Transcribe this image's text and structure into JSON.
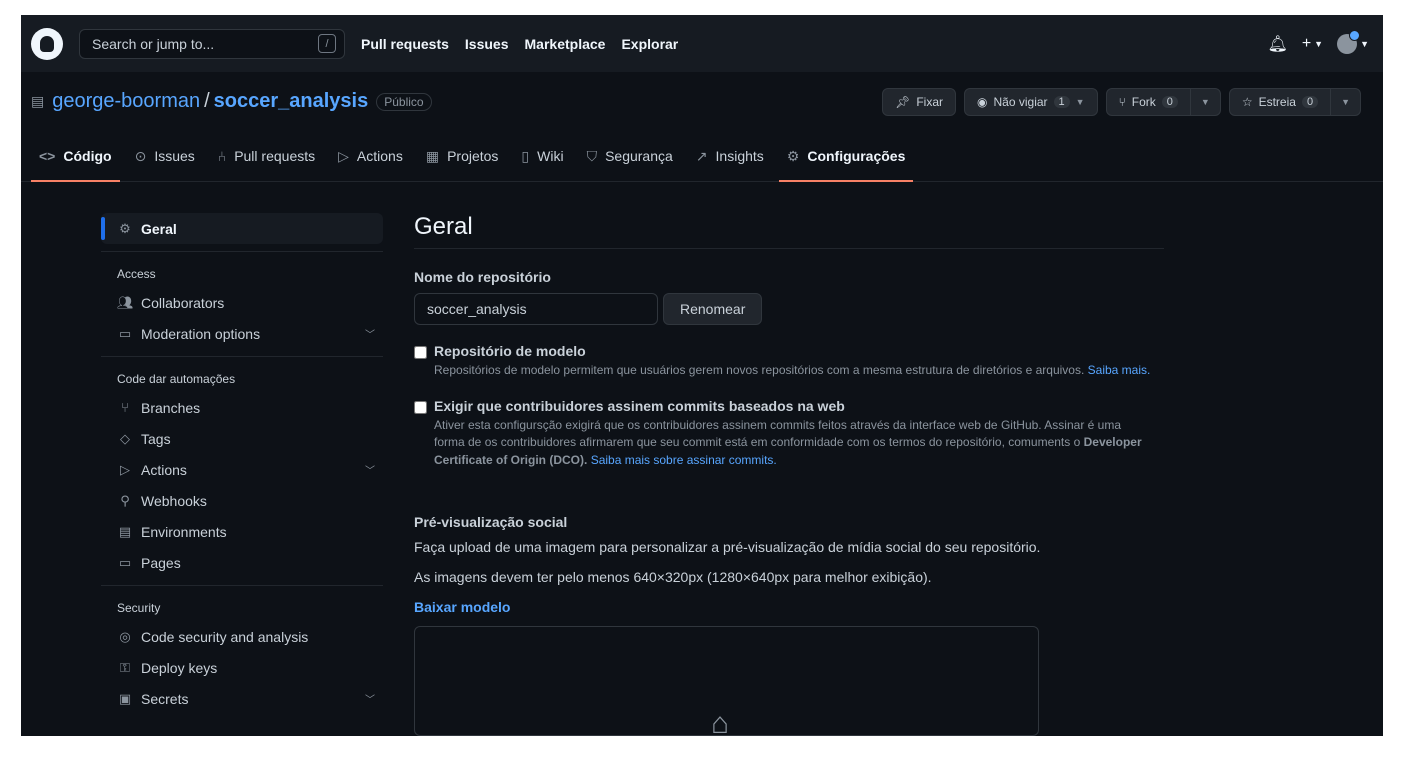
{
  "header": {
    "search_placeholder": "Search or jump to...",
    "search_shortcut": "/",
    "nav": [
      "Pull requests",
      "Issues",
      "Marketplace",
      "Explorar"
    ]
  },
  "repo": {
    "owner": "george-boorman",
    "separator": "/",
    "name": "soccer_analysis",
    "visibility": "Público",
    "pin_label": "Fixar",
    "watch_label": "Não vigiar",
    "watch_count": "1",
    "fork_label": "Fork",
    "fork_count": "0",
    "star_label": "Estreia",
    "star_count": "0"
  },
  "tabs": [
    {
      "label": "Código",
      "icon": "code-icon"
    },
    {
      "label": "Issues",
      "icon": "issue-icon"
    },
    {
      "label": "Pull requests",
      "icon": "pull-request-icon"
    },
    {
      "label": "Actions",
      "icon": "play-icon"
    },
    {
      "label": "Projetos",
      "icon": "table-icon"
    },
    {
      "label": "Wiki",
      "icon": "book-icon"
    },
    {
      "label": "Segurança",
      "icon": "shield-icon"
    },
    {
      "label": "Insights",
      "icon": "graph-icon"
    },
    {
      "label": "Configurações",
      "icon": "gear-icon"
    }
  ],
  "sidebar": {
    "general": "Geral",
    "access_heading": "Access",
    "access": [
      "Collaborators",
      "Moderation options"
    ],
    "code_heading": "Code dar automações",
    "code": [
      "Branches",
      "Tags",
      "Actions",
      "Webhooks",
      "Environments",
      "Pages"
    ],
    "security_heading": "Security",
    "security": [
      "Code security and analysis",
      "Deploy keys",
      "Secrets"
    ]
  },
  "main": {
    "title": "Geral",
    "repo_name_label": "Nome do repositório",
    "repo_name_value": "soccer_analysis",
    "rename_button": "Renomear",
    "template_title": "Repositório de modelo",
    "template_note": "Repositórios de modelo permitem que usuários gerem novos repositórios com a mesma estrutura de diretórios e arquivos.",
    "template_link": "Saiba mais.",
    "signoff_title": "Exigir que contribuidores assinem commits baseados na web",
    "signoff_note": "Ativer esta configursção exigirá que os contribuidores assinem commits feitos através da interface web de GitHub. Assinar é uma forma de os contribuidores afirmarem que seu commit está em conformidade com os termos do repositório, comuments o ",
    "signoff_strong": "Developer Certificate of Origin (DCO).",
    "signoff_link": "Saiba mais sobre assinar commits.",
    "social_title": "Pré-visualização social",
    "social_p1": "Faça upload de uma imagem para personalizar a pré-visualização de mídia social do seu repositório.",
    "social_p2": "As imagens devem ter pelo menos 640×320px (1280×640px para melhor exibição).",
    "download_link": "Baixar modelo"
  }
}
